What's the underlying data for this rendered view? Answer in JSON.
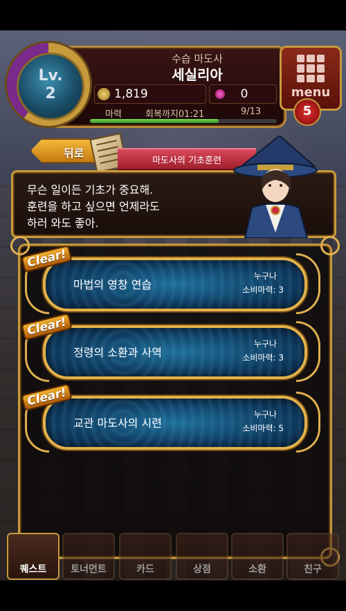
{
  "hud": {
    "level_label": "Lv.",
    "level_value": "2",
    "rank": "수습 마도사",
    "name": "세실리아",
    "gold": "1,819",
    "gems": "0",
    "mana_label": "마력",
    "recover_label": "회복까지01:21",
    "mana_count": "9/13",
    "mana_fraction": 0.69
  },
  "menu": {
    "label": "menu",
    "badge": "5"
  },
  "header": {
    "back_label": "뒤로",
    "npc_title": "마도사의 기초훈련"
  },
  "dialog": {
    "lines": [
      "무슨 일이든 기초가 중요해.",
      "훈련을 하고 싶으면 언제라도",
      "하러 와도 좋아."
    ]
  },
  "quests": [
    {
      "badge": "Clear!",
      "name": "마법의 영창 연습",
      "who": "누구나",
      "cost": "소비마력: 3"
    },
    {
      "badge": "Clear!",
      "name": "정령의 소환과 사역",
      "who": "누구나",
      "cost": "소비마력: 3"
    },
    {
      "badge": "Clear!",
      "name": "교관 마도사의 시련",
      "who": "누구나",
      "cost": "소비마력: 5"
    }
  ],
  "nav": {
    "items": [
      {
        "label": "퀘스트"
      },
      {
        "label": "토너먼트"
      },
      {
        "label": "카드"
      },
      {
        "label": "상점"
      },
      {
        "label": "소환"
      },
      {
        "label": "친구"
      }
    ]
  },
  "colors": {
    "gold_trim": "#c79a3c",
    "quest_blue": "#0f3d62",
    "mana_green": "#4fb53a",
    "title_red": "#c0303c"
  },
  "icons": [
    "coin-icon",
    "gem-icon",
    "menu-grid-icon",
    "scroll-icon",
    "back-arrow-icon"
  ]
}
